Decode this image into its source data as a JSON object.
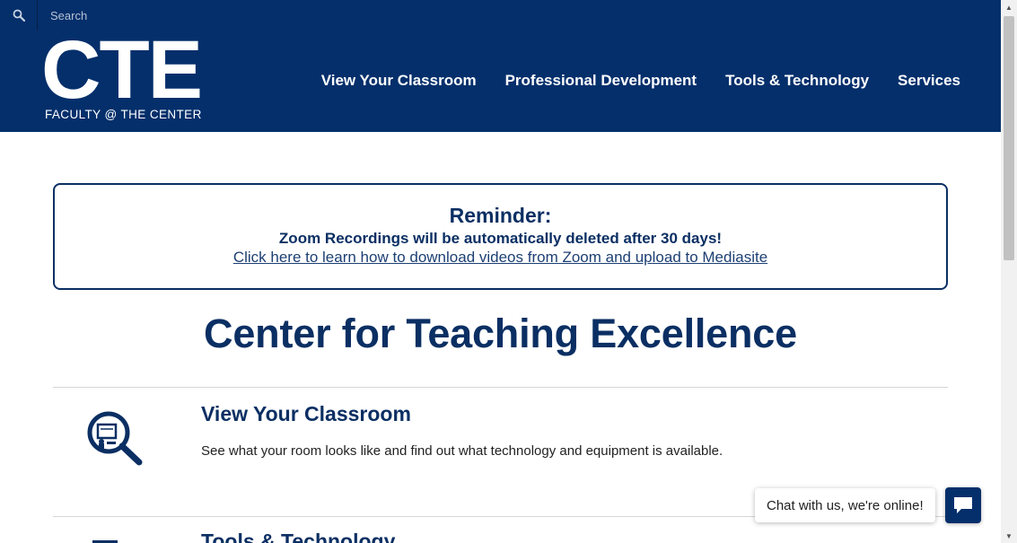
{
  "search": {
    "placeholder": "Search",
    "icon": "search-icon"
  },
  "logo": {
    "letters": "CTE",
    "subtitle": "FACULTY @ THE CENTER"
  },
  "nav": {
    "items": [
      {
        "label": "View Your Classroom"
      },
      {
        "label": "Professional Development"
      },
      {
        "label": "Tools & Technology"
      },
      {
        "label": "Services"
      }
    ]
  },
  "reminder": {
    "title": "Reminder:",
    "line": "Zoom Recordings will be automatically deleted after 30 days!",
    "link": "Click here to learn how to download videos from Zoom and upload to Mediasite"
  },
  "page_title": "Center for Teaching Excellence",
  "sections": [
    {
      "title": "View Your Classroom",
      "description": "See what your room looks like and find out what technology and equipment is available.",
      "icon": "classroom-search-icon"
    },
    {
      "title": "Tools & Technology",
      "icon": "tools-icon"
    }
  ],
  "chat": {
    "label": "Chat with us, we're online!",
    "icon": "chat-icon"
  },
  "colors": {
    "brand": "#042f6b",
    "heading": "#0b2f63",
    "text": "#222222"
  }
}
